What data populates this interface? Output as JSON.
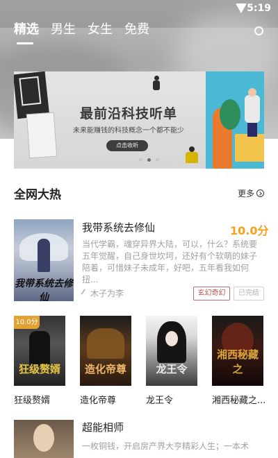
{
  "status_bar": {
    "time": "5:19"
  },
  "tabs": [
    {
      "label": "精选",
      "active": true
    },
    {
      "label": "男生",
      "active": false
    },
    {
      "label": "女生",
      "active": false
    },
    {
      "label": "免费",
      "active": false
    }
  ],
  "banner": {
    "headline": "最前沿科技听单",
    "subline": "未来能赚钱的科技概念一个都不能少",
    "cta_label": "点击收听",
    "slide_count": 3,
    "active_slide": 2
  },
  "section": {
    "title": "全网大热",
    "more_label": "更多"
  },
  "featured_book": {
    "title": "我带系统去修仙",
    "cover_text": "我带系统去修仙",
    "score": "10.0分",
    "description": "当代学霸，魂穿异界大陆，可以，什么？系统要五年觉醒，自己身世坎坷，还好有个软萌的妹子陪着，可惜妹子未成年，好吧，五年看我如何扭...",
    "author": "木子为李",
    "genre_tag": "玄幻奇幻",
    "status_tag": "已完结"
  },
  "grid_books": [
    {
      "name": "狂级赘婿",
      "cover_text": "狂级赘婿",
      "score_badge": "10.0分"
    },
    {
      "name": "造化帝尊",
      "cover_text": "造化帝尊",
      "score_badge": ""
    },
    {
      "name": "龙王令",
      "cover_text": "龙王令",
      "score_badge": ""
    },
    {
      "name": "湘西秘藏之...",
      "cover_text": "湘西秘藏之",
      "score_badge": ""
    }
  ],
  "bottom_book": {
    "title": "超能相师",
    "description": "一枚铜钱，开启房产界大亨精彩人生；一本术"
  },
  "colors": {
    "score_orange": "#f2a21b",
    "genre_red": "#c0504d",
    "badge_gold": "#e2a233"
  }
}
